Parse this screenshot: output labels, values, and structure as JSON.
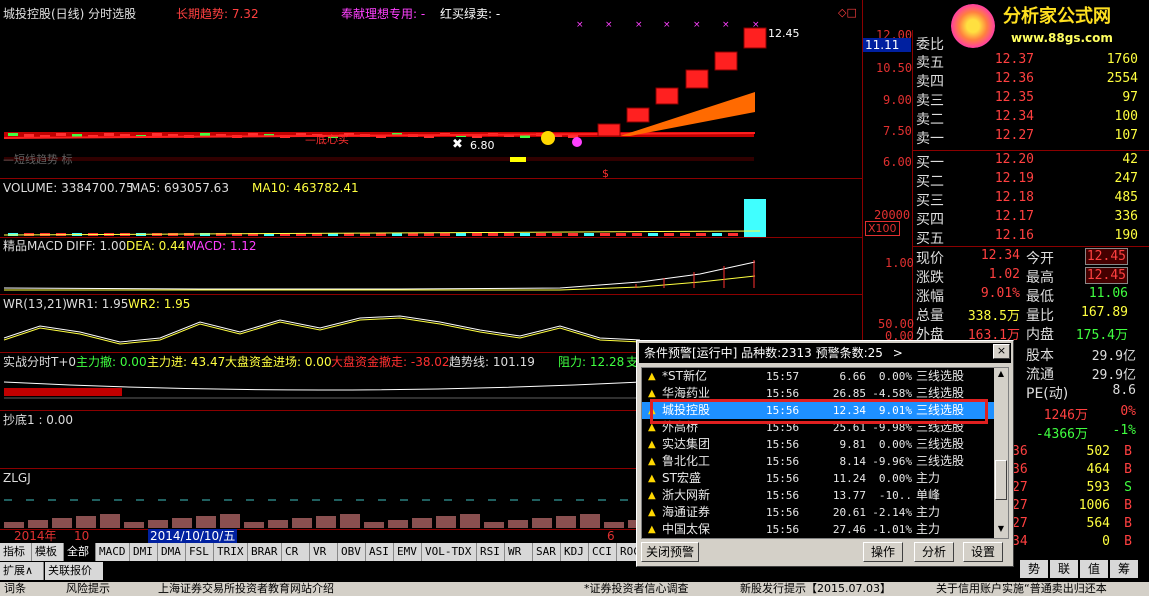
{
  "header": {
    "stock_title": "城投控股(日线) 分时选股",
    "indicator1": "长期趋势: 7.32",
    "indicator2": "奉献理想专用: -",
    "indicator3": "红买绿卖: -"
  },
  "logo": {
    "title": "分析家公式网",
    "url": "www.88gs.com"
  },
  "main_chart": {
    "price_labels": [
      "12.00",
      "10.50",
      "9.00",
      "7.50",
      "6.00"
    ],
    "current_price_box": "11.11",
    "high_label": "12.45",
    "low_label": "6.80",
    "annotation_mid": "—底心买",
    "annotation_left": "—短线趋势 标",
    "dollar_mark": "$"
  },
  "volume_panel": {
    "label_volume": "VOLUME: 3384700.75",
    "label_ma5": "MA5: 693057.63",
    "label_ma10": "MA10: 463782.41",
    "axis_top": "20000",
    "axis_unit": "X100"
  },
  "macd_panel": {
    "label_name": "精品MACD",
    "label_diff": "DIFF: 1.00",
    "label_dea": "DEA: 0.44",
    "label_macd": "MACD: 1.12",
    "axis": "1.00"
  },
  "wr_panel": {
    "label_name": "WR(13,21)",
    "label_wr1": "WR1: 1.95",
    "label_wr2": "WR2: 1.95",
    "axis1": "50.00",
    "axis2": "0.00"
  },
  "flow_panel": {
    "label_name": "实战分时T+0",
    "label_out": "主力撤: 0.00",
    "label_in": "主力进: 43.47",
    "label_big_in": "大盘资金进场: 0.00",
    "label_big_out": "大盘资金撤走: -38.02",
    "label_trend": "趋势线: 101.19",
    "label_resist": "阻力: 12.28",
    "label_resist_tail": "支"
  },
  "bottom_panel": {
    "label": "抄底1 : 0.00"
  },
  "zlgj_panel": {
    "label": "ZLGJ"
  },
  "date_axis": {
    "year": "2014年",
    "month1": "10",
    "cursor_date": "2014/10/10/五",
    "month2": "6"
  },
  "tabs": [
    "指标",
    "模板",
    "全部",
    "MACD",
    "DMI",
    "DMA",
    "FSL",
    "TRIX",
    "BRAR",
    "CR",
    "VR",
    "OBV",
    "ASI",
    "EMV",
    "VOL-TDX",
    "RSI",
    "WR",
    "SAR",
    "KDJ",
    "CCI",
    "ROC",
    "MTM",
    "BOL"
  ],
  "tabs2": [
    "扩展∧",
    "关联报价"
  ],
  "orderbook": {
    "weibi_label": "委比",
    "sells": [
      {
        "label": "卖五",
        "price": "12.37",
        "vol": "1760"
      },
      {
        "label": "卖四",
        "price": "12.36",
        "vol": "2554"
      },
      {
        "label": "卖三",
        "price": "12.35",
        "vol": "97"
      },
      {
        "label": "卖二",
        "price": "12.34",
        "vol": "100"
      },
      {
        "label": "卖一",
        "price": "12.27",
        "vol": "107"
      }
    ],
    "buys": [
      {
        "label": "买一",
        "price": "12.20",
        "vol": "42"
      },
      {
        "label": "买二",
        "price": "12.19",
        "vol": "247"
      },
      {
        "label": "买三",
        "price": "12.18",
        "vol": "485"
      },
      {
        "label": "买四",
        "price": "12.17",
        "vol": "336"
      },
      {
        "label": "买五",
        "price": "12.16",
        "vol": "190"
      }
    ]
  },
  "quotes": [
    {
      "l1": "现价",
      "v1": "12.34",
      "l2": "今开",
      "v2": "12.45"
    },
    {
      "l1": "涨跌",
      "v1": "1.02",
      "l2": "最高",
      "v2": "12.45"
    },
    {
      "l1": "涨幅",
      "v1": "9.01%",
      "l2": "最低",
      "v2": "11.06"
    },
    {
      "l1": "总量",
      "v1": "338.5万",
      "l2": "量比",
      "v2": "167.89"
    },
    {
      "l1": "外盘",
      "v1": "163.1万",
      "l2": "内盘",
      "v2": "175.4万"
    }
  ],
  "quotes2": [
    {
      "l": "股本",
      "v": "29.9亿"
    },
    {
      "l": "流通",
      "v": "29.9亿"
    },
    {
      "l": "PE(动)",
      "v": "8.6"
    }
  ],
  "flows": [
    {
      "v1": "1246万",
      "v2": "0%"
    },
    {
      "v1": "-4366万",
      "v2": "-1%"
    }
  ],
  "ticks": [
    {
      "p": "36",
      "v": "502",
      "f": "B"
    },
    {
      "p": "36",
      "v": "464",
      "f": "B"
    },
    {
      "p": "27",
      "v": "593",
      "f": "S"
    },
    {
      "p": "27",
      "v": "1006",
      "f": "B"
    },
    {
      "p": "27",
      "v": "564",
      "f": "B"
    },
    {
      "p": "34",
      "v": "0",
      "f": "B"
    }
  ],
  "bottom_right_tabs": [
    "势",
    "联",
    "值",
    "筹"
  ],
  "dialog": {
    "title": "条件预警[运行中] 品种数:2313 预警条数:25",
    "title_arrow": ">",
    "close": "×",
    "rows": [
      {
        "name": "*ST新亿",
        "time": "15:57",
        "price": "6.66",
        "pct": "0.00%",
        "cond": "三线选股"
      },
      {
        "name": "华海药业",
        "time": "15:56",
        "price": "26.85",
        "pct": "-4.58%",
        "cond": "三线选股"
      },
      {
        "name": "城投控股",
        "time": "15:56",
        "price": "12.34",
        "pct": "9.01%",
        "cond": "三线选股"
      },
      {
        "name": "外高桥",
        "time": "15:56",
        "price": "25.61",
        "pct": "-9.98%",
        "cond": "三线选股"
      },
      {
        "name": "实达集团",
        "time": "15:56",
        "price": "9.81",
        "pct": "0.00%",
        "cond": "三线选股"
      },
      {
        "name": "鲁北化工",
        "time": "15:56",
        "price": "8.14",
        "pct": "-9.96%",
        "cond": "三线选股"
      },
      {
        "name": "ST宏盛",
        "time": "15:56",
        "price": "11.24",
        "pct": "0.00%",
        "cond": "主力"
      },
      {
        "name": "浙大网新",
        "time": "15:56",
        "price": "13.77",
        "pct": "-10..",
        "cond": "单峰"
      },
      {
        "name": "海通证券",
        "time": "15:56",
        "price": "20.61",
        "pct": "-2.14%",
        "cond": "主力"
      },
      {
        "name": "中国太保",
        "time": "15:56",
        "price": "27.46",
        "pct": "-1.01%",
        "cond": "主力"
      }
    ],
    "btn_close_alert": "关闭预警",
    "btn_operate": "操作",
    "btn_analyze": "分析",
    "btn_settings": "设置"
  },
  "statusbar": [
    "词条",
    "风险提示",
    "上海证券交易所投资者教育网站介绍",
    "*证券投资者信心调查",
    "新股发行提示【2015.07.03】",
    "关于信用账户实施“普通卖出归还本"
  ],
  "colors": {
    "up": "#ff3030",
    "down": "#00ff40",
    "bg": "#000000",
    "grid": "#8b0000",
    "select": "#1e90ff"
  }
}
